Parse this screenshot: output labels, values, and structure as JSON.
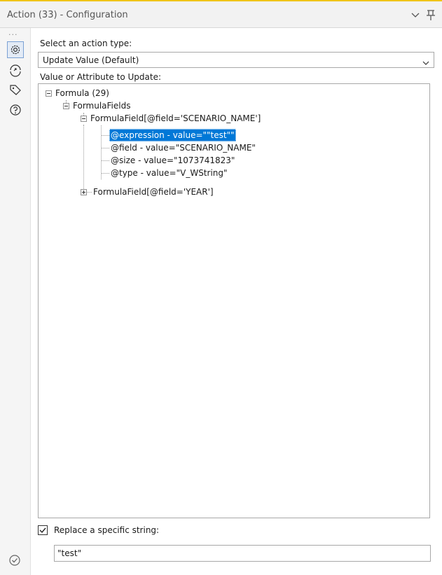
{
  "window": {
    "title": "Action (33) - Configuration"
  },
  "icons": {
    "titlebar": [
      "chevron-down-icon",
      "pin-icon"
    ],
    "rail": [
      "gear-icon",
      "connection-icon",
      "tag-icon",
      "help-icon"
    ],
    "status": "check-circle-icon"
  },
  "form": {
    "action_type_label": "Select an action type:",
    "action_type_value": "Update Value (Default)",
    "update_label": "Value or Attribute to Update:"
  },
  "tree": {
    "formula": "Formula (29)",
    "formula_fields": "FormulaFields",
    "scenario_field": "FormulaField[@field='SCENARIO_NAME']",
    "attr_expression": "@expression - value=\"\"test\"\"",
    "attr_field": "@field - value=\"SCENARIO_NAME\"",
    "attr_size": "@size - value=\"1073741823\"",
    "attr_type": "@type - value=\"V_WString\"",
    "year_field": "FormulaField[@field='YEAR']"
  },
  "replace": {
    "checked": true,
    "label": "Replace a specific string:",
    "value": "\"test\""
  },
  "colors": {
    "selection": "#0078d7",
    "accent_line": "#f0c419",
    "border": "#a8a8a8"
  }
}
